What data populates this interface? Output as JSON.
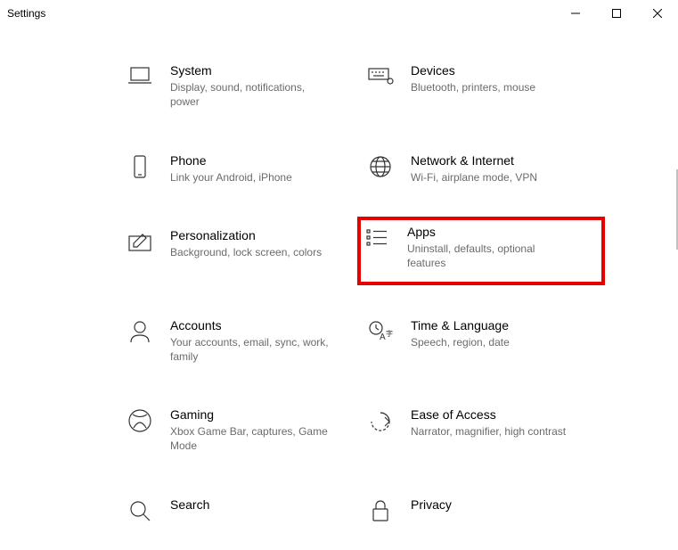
{
  "window": {
    "title": "Settings"
  },
  "tiles": {
    "system": {
      "title": "System",
      "desc": "Display, sound, notifications, power"
    },
    "devices": {
      "title": "Devices",
      "desc": "Bluetooth, printers, mouse"
    },
    "phone": {
      "title": "Phone",
      "desc": "Link your Android, iPhone"
    },
    "network": {
      "title": "Network & Internet",
      "desc": "Wi-Fi, airplane mode, VPN"
    },
    "personalization": {
      "title": "Personalization",
      "desc": "Background, lock screen, colors"
    },
    "apps": {
      "title": "Apps",
      "desc": "Uninstall, defaults, optional features"
    },
    "accounts": {
      "title": "Accounts",
      "desc": "Your accounts, email, sync, work, family"
    },
    "time": {
      "title": "Time & Language",
      "desc": "Speech, region, date"
    },
    "gaming": {
      "title": "Gaming",
      "desc": "Xbox Game Bar, captures, Game Mode"
    },
    "ease": {
      "title": "Ease of Access",
      "desc": "Narrator, magnifier, high contrast"
    },
    "search": {
      "title": "Search",
      "desc": ""
    },
    "privacy": {
      "title": "Privacy",
      "desc": ""
    }
  }
}
